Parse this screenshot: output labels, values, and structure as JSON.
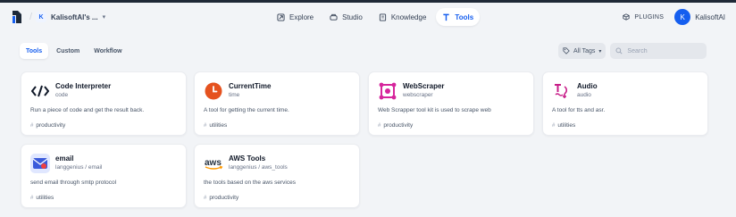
{
  "header": {
    "workspace": {
      "initial": "K",
      "name": "KalisoftAI's ..."
    },
    "nav": [
      {
        "label": "Explore",
        "icon": "explore-icon"
      },
      {
        "label": "Studio",
        "icon": "studio-icon"
      },
      {
        "label": "Knowledge",
        "icon": "knowledge-icon"
      },
      {
        "label": "Tools",
        "icon": "tools-icon"
      }
    ],
    "plugins_label": "PLUGINS",
    "user": {
      "initial": "K",
      "name": "KalisoftAI"
    }
  },
  "tabs": [
    "Tools",
    "Custom",
    "Workflow"
  ],
  "filters": {
    "tags_label": "All Tags",
    "search_placeholder": "Search"
  },
  "colors": {
    "accent": "#155eef",
    "background": "#f2f4f7",
    "card": "#ffffff"
  },
  "tools": [
    {
      "title": "Code Interpreter",
      "subtitle": "code",
      "description": "Run a piece of code and get the result back.",
      "tag": "productivity",
      "icon": "code-icon"
    },
    {
      "title": "CurrentTime",
      "subtitle": "time",
      "description": "A tool for getting the current time.",
      "tag": "utilities",
      "icon": "clock-icon"
    },
    {
      "title": "WebScraper",
      "subtitle": "webscraper",
      "description": "Web Scrapper tool kit is used to scrape web",
      "tag": "productivity",
      "icon": "webscraper-icon"
    },
    {
      "title": "Audio",
      "subtitle": "audio",
      "description": "A tool for tts and asr.",
      "tag": "utilities",
      "icon": "audio-icon"
    },
    {
      "title": "email",
      "subtitle": "langgenius / email",
      "description": "send email through smtp protocol",
      "tag": "utilities",
      "icon": "email-icon"
    },
    {
      "title": "AWS Tools",
      "subtitle": "langgenius / aws_tools",
      "description": "the tools based on the aws services",
      "tag": "productivity",
      "icon": "aws-icon"
    }
  ]
}
